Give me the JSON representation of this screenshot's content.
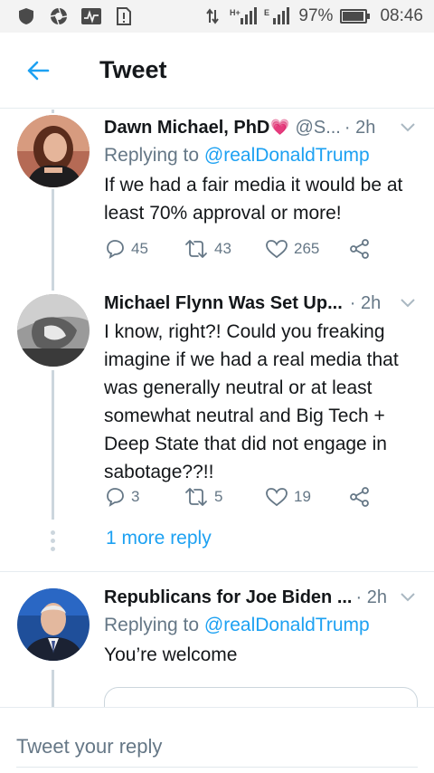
{
  "status_bar": {
    "network": "4G",
    "battery": "97%",
    "battery_level": 0.97,
    "time": "08:46",
    "icons": [
      "shield-icon",
      "aperture-icon",
      "activity-icon",
      "sim-icon",
      "data-transfer-icon",
      "signal-icon",
      "signal-icon",
      "battery-icon"
    ]
  },
  "header": {
    "title": "Tweet",
    "back_icon": "arrow-left-icon"
  },
  "tweets": [
    {
      "name": "Dawn Michael, PhD",
      "name_emoji": "💗",
      "handle": "@S...",
      "time": "· 2h",
      "reply_prefix": "Replying to ",
      "reply_to": "@realDonaldTrump",
      "text": "If we had a fair media it would be at least 70% approval or more!",
      "replies": "45",
      "retweets": "43",
      "likes": "265"
    },
    {
      "name": "Michael Flynn Was Set Up...",
      "time": "· 2h",
      "text": "I know, right?! Could you freaking imagine if we had a real media that was generally neutral or at least somewhat neutral and Big Tech + Deep State that did not engage in sabotage??!!",
      "replies": "3",
      "retweets": "5",
      "likes": "19"
    },
    {
      "name": "Republicans for Joe Biden ...",
      "time": "· 2h",
      "reply_prefix": "Replying to ",
      "reply_to": "@realDonaldTrump",
      "text": "You’re welcome"
    }
  ],
  "more_replies": "1 more reply",
  "composer": {
    "placeholder": "Tweet your reply"
  },
  "colors": {
    "accent": "#1da1f2",
    "secondary_text": "#657786",
    "primary_text": "#14171a",
    "like_heart": "#e0245e"
  }
}
